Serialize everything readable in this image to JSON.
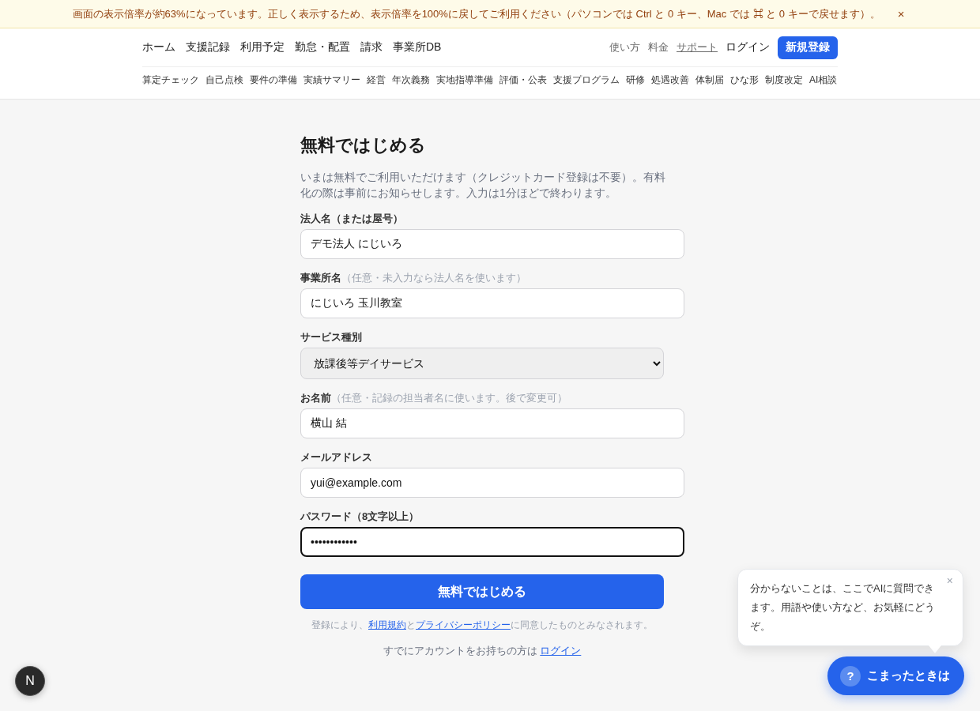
{
  "notice_banner": {
    "text": "画面の表示倍率が約63%になっています。正しく表示するため、表示倍率を100%に戻してご利用ください（パソコンでは Ctrl と 0 キー、Mac では ⌘ と 0 キーで戻せます）。",
    "close": "×"
  },
  "header": {
    "main_nav": [
      "ホーム",
      "支援記録",
      "利用予定",
      "勤怠・配置",
      "請求",
      "事業所DB"
    ],
    "utility_links": [
      {
        "label": "使い方",
        "selected": false
      },
      {
        "label": "料金",
        "selected": false
      },
      {
        "label": "サポート",
        "selected": true
      }
    ],
    "login": "ログイン",
    "signup_button": "新規登録",
    "sub_nav": [
      "算定チェック",
      "自己点検",
      "要件の準備",
      "実績サマリー",
      "経営",
      "年次義務",
      "実地指導準備",
      "評価・公表",
      "支援プログラム",
      "研修",
      "処遇改善",
      "体制届",
      "ひな形",
      "制度改定",
      "AI相談"
    ]
  },
  "form": {
    "title": "無料ではじめる",
    "description": "いまは無料でご利用いただけます（クレジットカード登録は不要）。有料化の際は事前にお知らせします。入力は1分ほどで終わります。",
    "fields": [
      {
        "kind": "text",
        "label": "法人名（または屋号）",
        "value": "デモ法人 にじいろ",
        "focused": false
      },
      {
        "kind": "text",
        "label": "事業所名",
        "hint": "（任意・未入力なら法人名を使います）",
        "value": "にじいろ 玉川教室",
        "focused": false
      },
      {
        "kind": "select",
        "label": "サービス種別",
        "value": "放課後等デイサービス",
        "focused": false
      },
      {
        "kind": "text",
        "label": "お名前",
        "hint": "（任意・記録の担当者名に使います。後で変更可）",
        "value": "横山 結",
        "focused": false
      },
      {
        "kind": "email",
        "label": "メールアドレス",
        "value": "yui@example.com",
        "focused": false
      },
      {
        "kind": "password",
        "label": "パスワード（8文字以上）",
        "value": "••••••••••••",
        "focused": true
      }
    ],
    "submit_button": "無料ではじめる",
    "terms": [
      {
        "kind": "text",
        "text": "登録により、"
      },
      {
        "kind": "link",
        "text": "利用規約"
      },
      {
        "kind": "text",
        "text": "と"
      },
      {
        "kind": "link",
        "text": "プライバシーポリシー"
      },
      {
        "kind": "text",
        "text": "に同意したものとみなされます。"
      }
    ],
    "login_prompt": {
      "text": "すでにアカウントをお持ちの方は",
      "link": "ログイン"
    }
  },
  "help_bubble": {
    "text": "分からないことは、ここでAIに質問できます。用語や使い方など、お気軽にどうぞ。",
    "close": "×"
  },
  "help_button": {
    "icon": "?",
    "label": "こまったときは"
  },
  "dev_indicator": {
    "label": "N"
  }
}
